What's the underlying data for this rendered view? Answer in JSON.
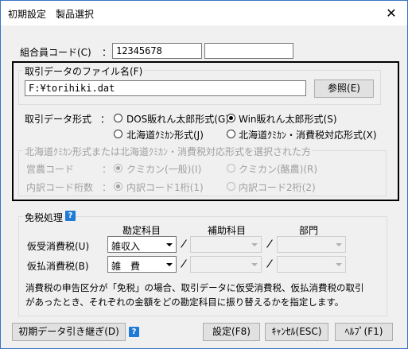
{
  "window": {
    "title": "初期設定　製品選択",
    "close_glyph": "✕"
  },
  "member_code": {
    "label": "組合員コード(C)",
    "colon": "：",
    "value": "12345678",
    "value2": ""
  },
  "file_group": {
    "label": "取引データのファイル名(F)",
    "path": "F:¥torihiki.dat",
    "browse_label": "参照(E)"
  },
  "format": {
    "label": "取引データ形式",
    "colon": "：",
    "options": [
      {
        "label": "DOS販れん太郎形式(G)",
        "checked": false
      },
      {
        "label": "Win販れん太郎形式(S)",
        "checked": true
      },
      {
        "label": "北海道ｸﾐｶﾝ形式(J)",
        "checked": false
      },
      {
        "label": "北海道ｸﾐｶﾝ・消費税対応形式(X)",
        "checked": false
      }
    ]
  },
  "hokkaido_group": {
    "label": "北海道ｸﾐｶﾝ形式または北海道ｸﾐｶﾝ・消費税対応形式を選択された方",
    "business_label": "営農コード",
    "business_colon": "：",
    "business_options": [
      {
        "label": "クミカン(一般)(I)",
        "checked": true
      },
      {
        "label": "クミカン(酪農)(R)",
        "checked": false
      }
    ],
    "digits_label": "内訳コード桁数",
    "digits_colon": "：",
    "digits_options": [
      {
        "label": "内訳コード1桁(1)",
        "checked": true
      },
      {
        "label": "内訳コード2桁(2)",
        "checked": false
      }
    ]
  },
  "tax_group": {
    "label": "免税処理",
    "help_glyph": "?",
    "col_headers": {
      "account": "勘定科目",
      "sub": "補助科目",
      "dept": "部門"
    },
    "rows": [
      {
        "label": "仮受消費税(U)",
        "account": "雑収入"
      },
      {
        "label": "仮払消費税(B)",
        "account": "雑　費"
      }
    ],
    "note_line1": "消費税の申告区分が「免税」の場合、取引データに仮受消費税、仮払消費税の取引",
    "note_line2": "があったとき、それぞれの金額をどの勘定科目に振り替えるかを指定します。"
  },
  "footer": {
    "carryover_label": "初期データ引き継ぎ(D)",
    "help_glyph": "?",
    "settings_label": "設定(F8)",
    "cancel_label": "ｷｬﾝｾﾙ(ESC)",
    "help_label": "ﾍﾙﾌﾟ(F1)"
  },
  "colors": {
    "accent": "#1e7ad6",
    "window_border": "#3b73c4",
    "disabled_text": "#a0a0a0"
  }
}
